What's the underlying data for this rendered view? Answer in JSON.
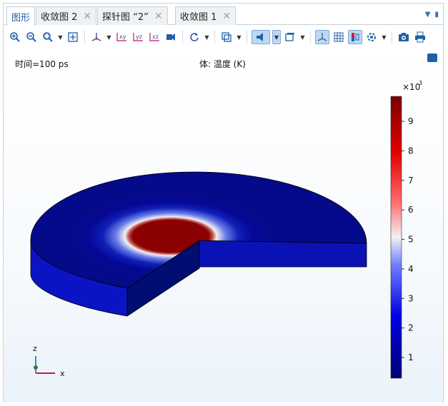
{
  "tabs": [
    {
      "label": "图形",
      "active": true,
      "closable": false
    },
    {
      "label": "收敛图 2",
      "active": false,
      "closable": true
    },
    {
      "label": "探针图 “2”",
      "active": false,
      "closable": true
    },
    {
      "label": "收敛图 1",
      "active": false,
      "closable": true
    }
  ],
  "close_glyph": "✕",
  "toolbar": {
    "icons": [
      "zoom-in-icon",
      "zoom-out-icon",
      "zoom-box-icon",
      "zoom-extents-icon",
      "axis-orient-icon",
      "view-xy-icon",
      "view-yz-icon",
      "view-xz-icon",
      "camera-view-icon",
      "rotate-icon",
      "transparency-icon",
      "light-icon",
      "render-icon",
      "grid-icon",
      "legend-icon",
      "scene-light-icon",
      "snapshot-icon",
      "print-icon"
    ]
  },
  "plot": {
    "time_label": "时间=100 ps",
    "expression_label": "体: 温度 (K)",
    "colorbar": {
      "scale_label": "×10",
      "scale_exponent": "3",
      "ticks": [
        "1",
        "2",
        "3",
        "4",
        "5",
        "6",
        "7",
        "8",
        "9"
      ],
      "colors": {
        "low": "#00007a",
        "mid": "#f2f2f2",
        "high": "#7a0000"
      }
    },
    "axes": {
      "z": "z",
      "x": "x"
    }
  }
}
